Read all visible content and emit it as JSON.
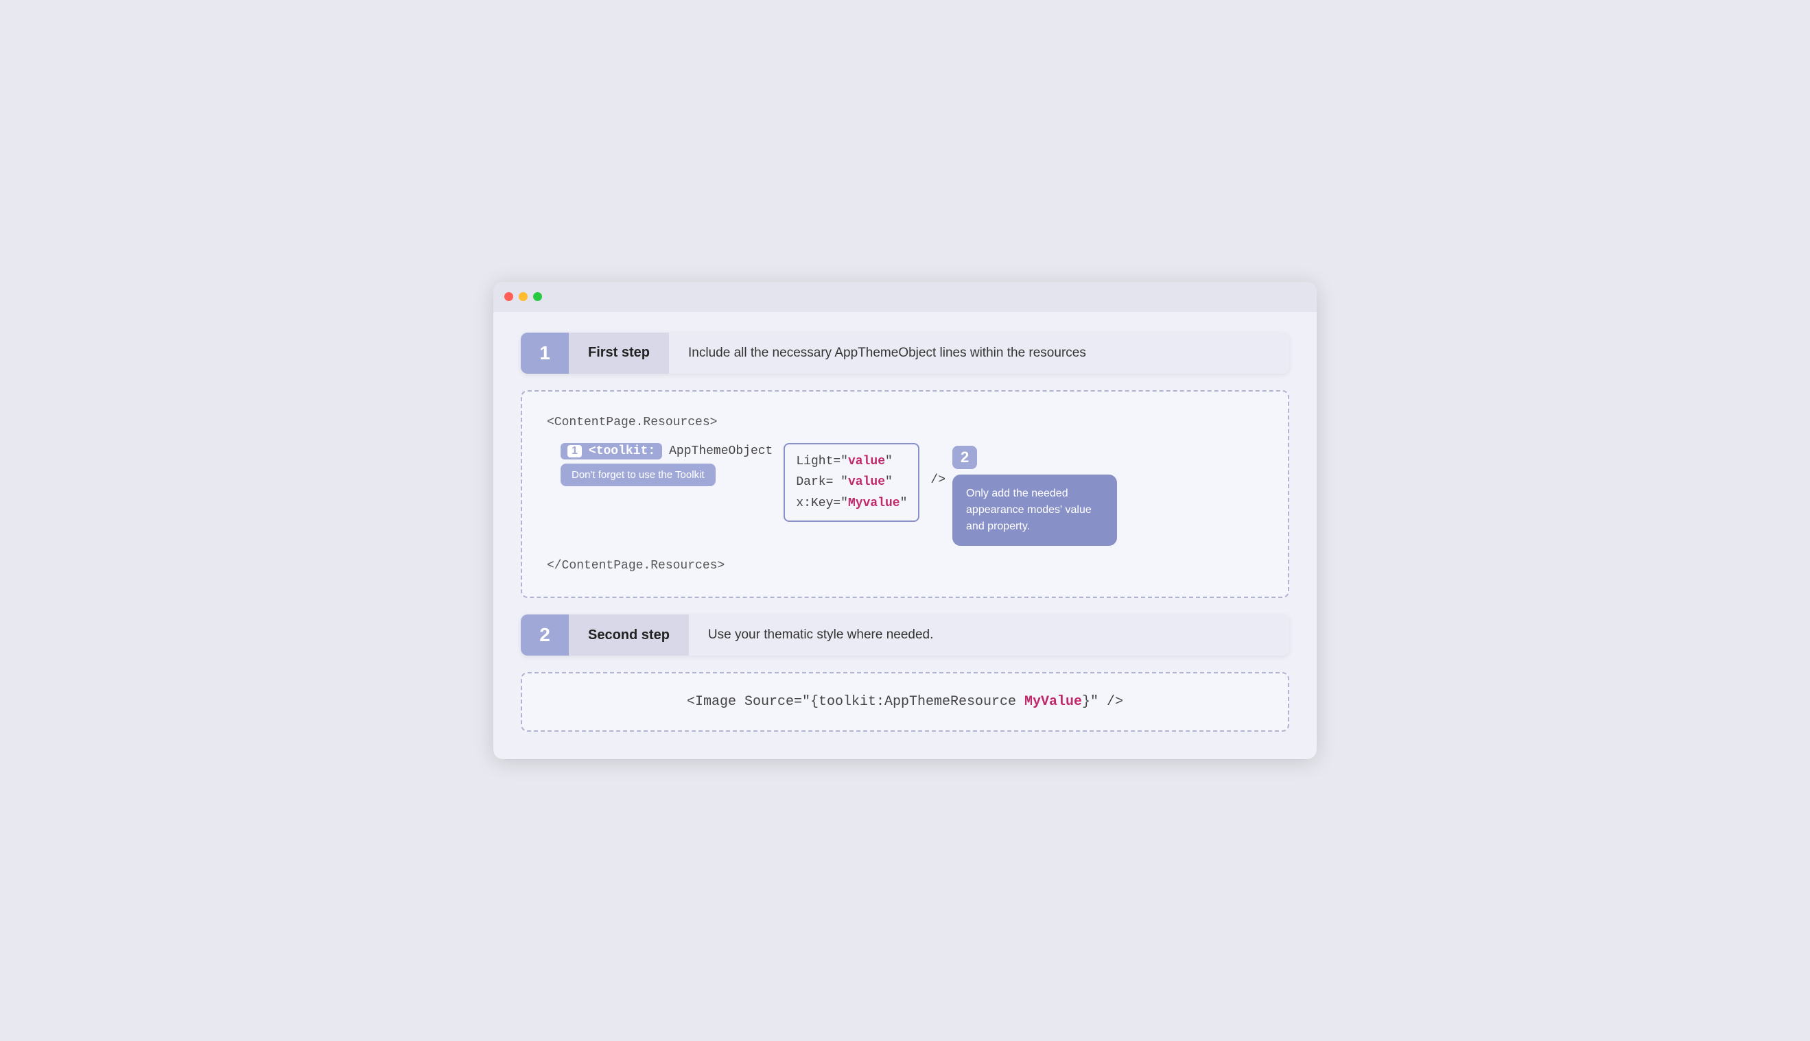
{
  "window": {
    "dots": [
      "red",
      "yellow",
      "green"
    ]
  },
  "step1": {
    "number": "1",
    "label": "First step",
    "description": "Include all the necessary AppThemeObject lines within the resources"
  },
  "step2": {
    "number": "2",
    "label": "Second step",
    "description": "Use your thematic style where needed."
  },
  "code1": {
    "open_tag": "<ContentPage.Resources>",
    "close_tag": "</ContentPage.Resources>",
    "badge_number": "1",
    "toolkit_text": "<toolkit:",
    "app_theme_text": "AppThemeObject",
    "tooltip": "Don't forget to use the Toolkit",
    "light_attr": "Light=\"",
    "light_value": "value",
    "dark_attr": "Dark= \"",
    "dark_value": "value",
    "key_attr": "x:Key=\"",
    "key_value": "Myvalue",
    "self_close": "/>",
    "note2_number": "2",
    "note2_text": "Only add the needed appearance modes' value and property."
  },
  "code2": {
    "line": "<Image Source=\"{toolkit:AppThemeResource ",
    "key_value": "MyValue",
    "line_end": "}\" />"
  }
}
